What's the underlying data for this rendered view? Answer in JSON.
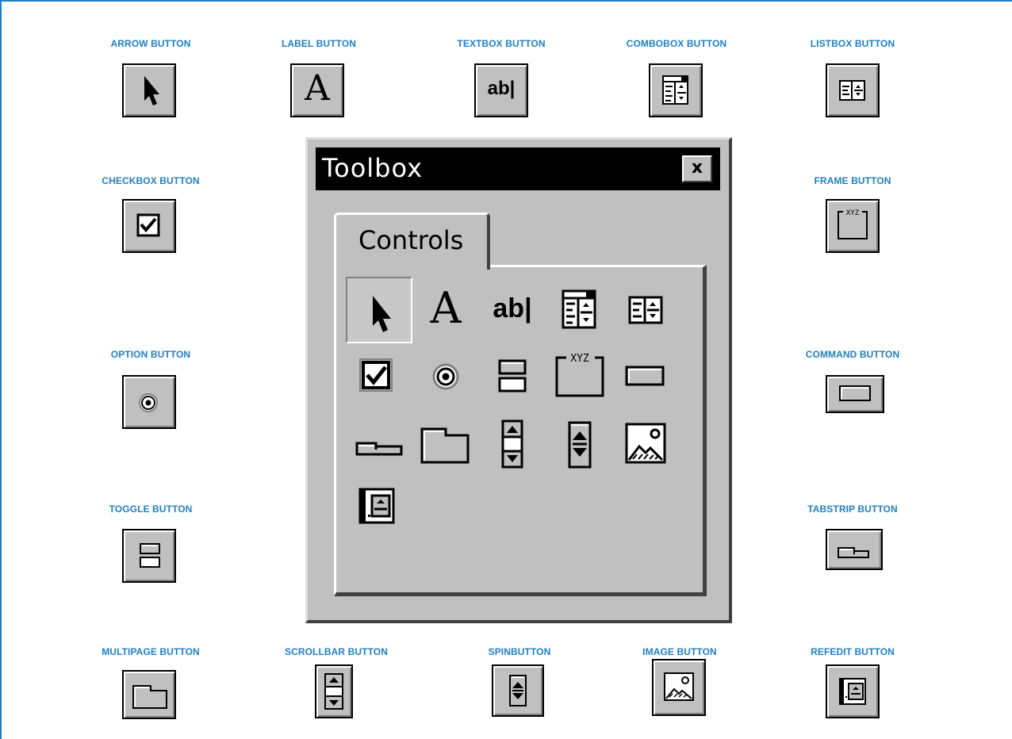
{
  "callouts": {
    "arrow": "ARROW BUTTON",
    "label": "LABEL BUTTON",
    "textbox": "TEXTBOX BUTTON",
    "combobox": "COMBOBOX BUTTON",
    "listbox": "LISTBOX BUTTON",
    "checkbox": "CHECKBOX BUTTON",
    "frame": "FRAME BUTTON",
    "option": "OPTION BUTTON",
    "command": "COMMAND BUTTON",
    "toggle": "TOGGLE BUTTON",
    "tabstrip": "TABSTRIP BUTTON",
    "multipage": "MULTIPAGE BUTTON",
    "scrollbar": "SCROLLBAR BUTTON",
    "spinbutton": "SPINBUTTON",
    "image": "IMAGE BUTTON",
    "refedit": "REFEDIT BUTTON"
  },
  "toolbox": {
    "title": "Toolbox",
    "close_glyph": "x",
    "tab_label": "Controls",
    "selected_tool": "arrow",
    "tools": [
      "arrow",
      "label",
      "textbox",
      "combobox",
      "listbox",
      "checkbox",
      "option",
      "toggle",
      "frame",
      "command",
      "tabstrip",
      "multipage",
      "scrollbar",
      "spinbutton",
      "image",
      "refedit"
    ],
    "label_glyph": "A",
    "textbox_glyph": "ab|",
    "frame_glyph": "XYZ"
  },
  "colors": {
    "caption": "#1f7fc2",
    "face": "#c0c0c0",
    "titlebar": "#000000"
  }
}
